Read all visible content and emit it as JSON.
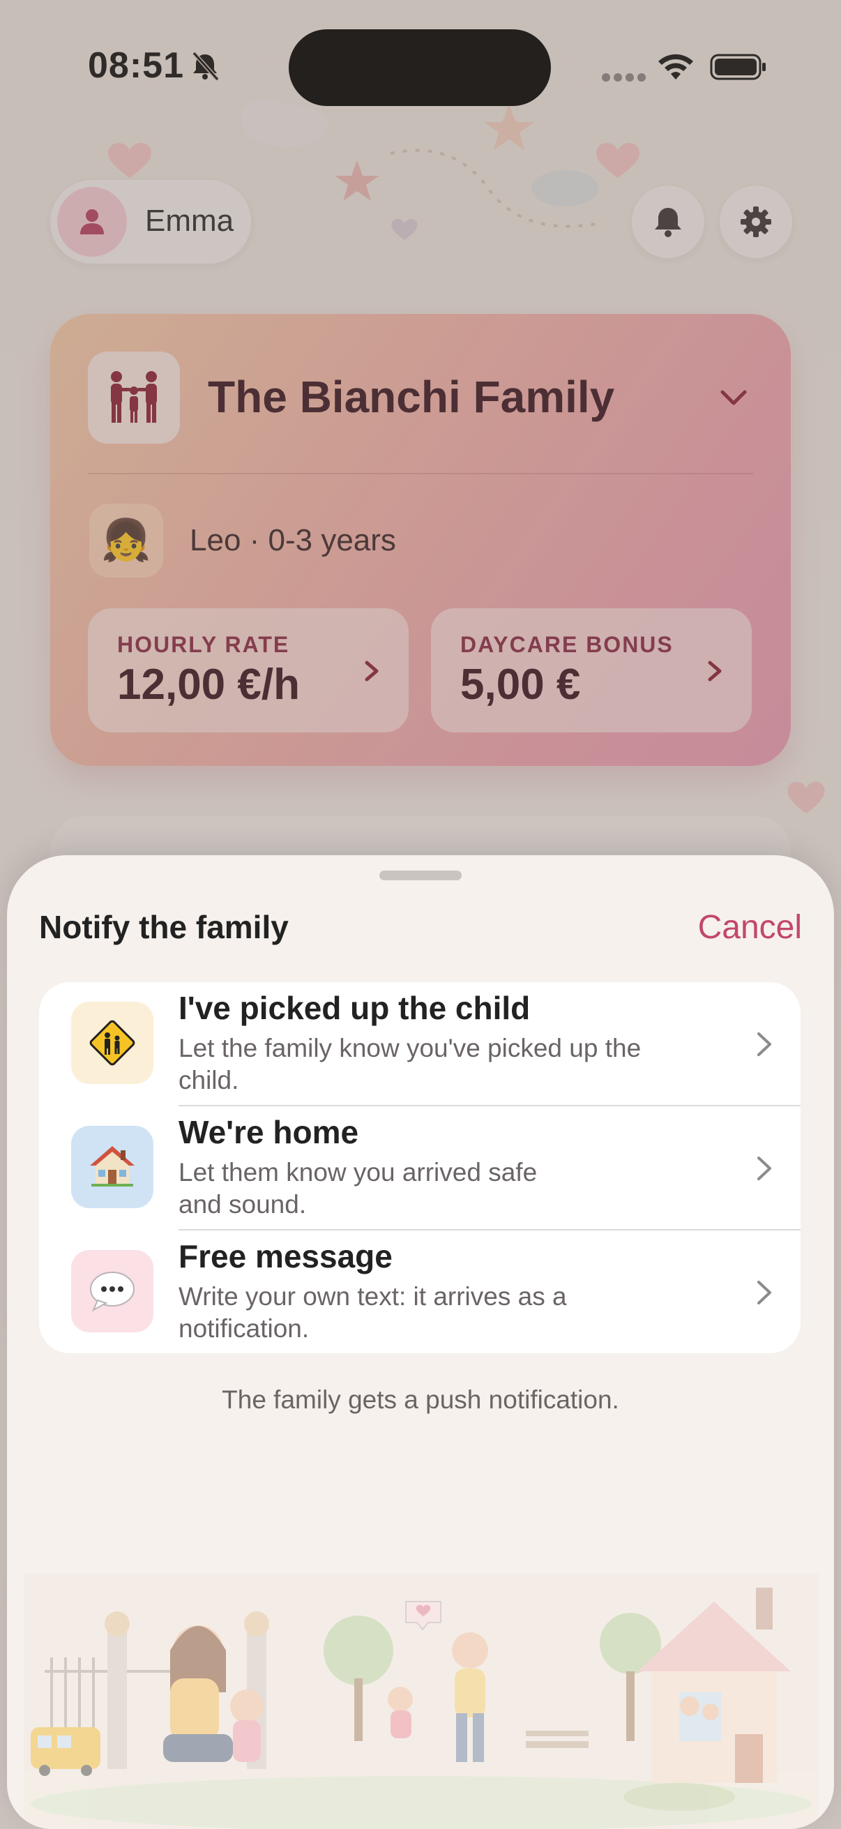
{
  "status_bar": {
    "time": "08:51"
  },
  "header": {
    "user_name": "Emma"
  },
  "family_card": {
    "title": "The Bianchi Family",
    "child": "Leo · 0-3 years",
    "child_emoji": "👧",
    "hourly_rate_label": "HOURLY RATE",
    "hourly_rate_value": "12,00 €/h",
    "daycare_bonus_label": "DAYCARE BONUS",
    "daycare_bonus_value": "5,00 €"
  },
  "sheet": {
    "title": "Notify the family",
    "cancel_label": "Cancel",
    "options": [
      {
        "title": "I've picked up the child",
        "description": "Let the family know you've picked up the child.",
        "icon": "school-crossing-sign-icon",
        "icon_bg": "#fcefd8"
      },
      {
        "title": "We're home",
        "description": "Let them know you arrived safe and sound.",
        "icon": "house-icon",
        "icon_bg": "#cfe3f5"
      },
      {
        "title": "Free message",
        "description": "Write your own text: it arrives as a notification.",
        "icon": "speech-bubble-icon",
        "icon_bg": "#fbe0e6"
      }
    ],
    "footnote": "The family gets a push notification."
  },
  "colors": {
    "accent": "#c2476a",
    "card_gradient_start": "#f3c9a8",
    "card_gradient_end": "#e99ab0",
    "sheet_bg": "#f6f1ec"
  }
}
